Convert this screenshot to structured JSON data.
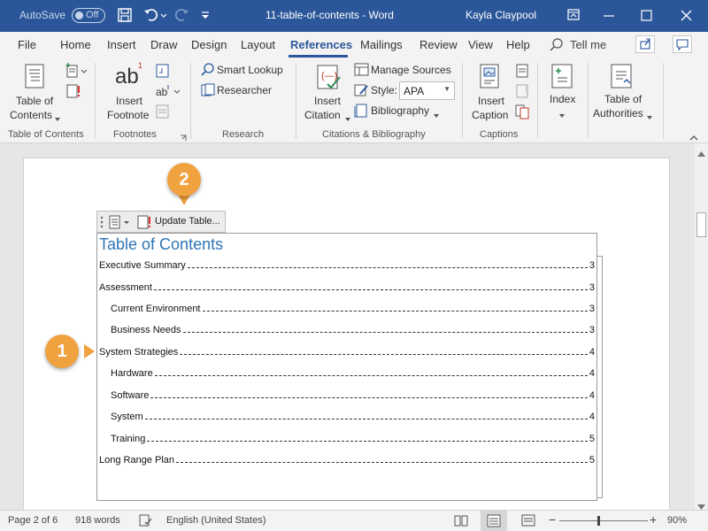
{
  "titlebar": {
    "autosave_label": "AutoSave",
    "autosave_state": "Off",
    "doc_title": "11-table-of-contents - Word",
    "user_name": "Kayla Claypool"
  },
  "tabs": {
    "items": [
      "File",
      "Home",
      "Insert",
      "Draw",
      "Design",
      "Layout",
      "References",
      "Mailings",
      "Review",
      "View",
      "Help"
    ],
    "active": "References",
    "tell_me": "Tell me"
  },
  "ribbon": {
    "toc": {
      "line1": "Table of",
      "line2": "Contents",
      "group": "Table of Contents"
    },
    "footnotes": {
      "big_icon": "ab",
      "line1": "Insert",
      "line2": "Footnote",
      "group": "Footnotes"
    },
    "research": {
      "smart_lookup": "Smart Lookup",
      "researcher": "Researcher",
      "group": "Research"
    },
    "citations": {
      "line1": "Insert",
      "line2": "Citation",
      "manage_sources": "Manage Sources",
      "style_label": "Style:",
      "style_value": "APA",
      "bibliography": "Bibliography",
      "group": "Citations & Bibliography"
    },
    "captions": {
      "line1": "Insert",
      "line2": "Caption",
      "group": "Captions"
    },
    "index": {
      "label": "Index"
    },
    "authorities": {
      "line1": "Table of",
      "line2": "Authorities"
    }
  },
  "toc": {
    "update_button": "Update Table...",
    "title": "Table of Contents",
    "entries": [
      {
        "text": "Executive Summary",
        "page": "3"
      },
      {
        "text": "Assessment",
        "page": "3"
      },
      {
        "text": "Current Environment",
        "page": "3"
      },
      {
        "text": "Business Needs",
        "page": "3"
      },
      {
        "text": "System Strategies",
        "page": "4"
      },
      {
        "text": "Hardware",
        "page": "4"
      },
      {
        "text": "Software",
        "page": "4"
      },
      {
        "text": "System",
        "page": "4"
      },
      {
        "text": "Training",
        "page": "5"
      },
      {
        "text": "Long Range Plan",
        "page": "5"
      }
    ]
  },
  "callouts": {
    "one": "1",
    "two": "2"
  },
  "status": {
    "page": "Page 2 of 6",
    "words": "918 words",
    "language": "English (United States)",
    "zoom": "90%",
    "zoom_level": 0.9
  },
  "colors": {
    "titlebar": "#2b579a",
    "accent": "#2b579a",
    "toc_title": "#2e74b5",
    "callout": "#f0a23e"
  }
}
